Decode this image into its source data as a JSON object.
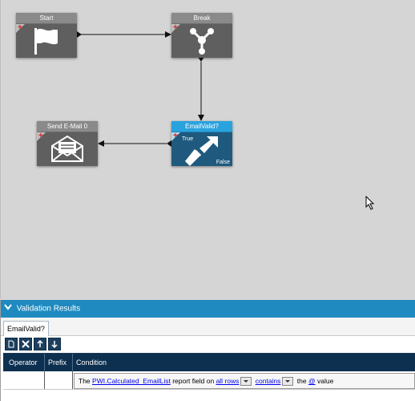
{
  "workflow": {
    "nodes": {
      "start": {
        "title": "Start",
        "icon": "flag-icon"
      },
      "break": {
        "title": "Break",
        "icon": "branch-icon"
      },
      "send": {
        "title": "Send E-Mail 0",
        "icon": "envelope-icon"
      },
      "valid": {
        "title": "EmailValid?",
        "icon": "arrow-icon",
        "true_label": "True",
        "false_label": "False"
      }
    }
  },
  "validation": {
    "header": "Validation Results",
    "tab": "EmailValid?",
    "columns": [
      "Operator",
      "Prefix",
      "Condition"
    ],
    "condition": {
      "prefix_text": "The",
      "field": "PWI.Calculated_EmailList",
      "mid_text": "report field on",
      "rows_option": "all rows",
      "operator_option": "contains",
      "the_text": "the",
      "at_symbol": "@",
      "value_text": "value"
    }
  },
  "colors": {
    "accent": "#29a3de",
    "header_bar": "#1f8ac0",
    "grid_header": "#0d3050"
  }
}
